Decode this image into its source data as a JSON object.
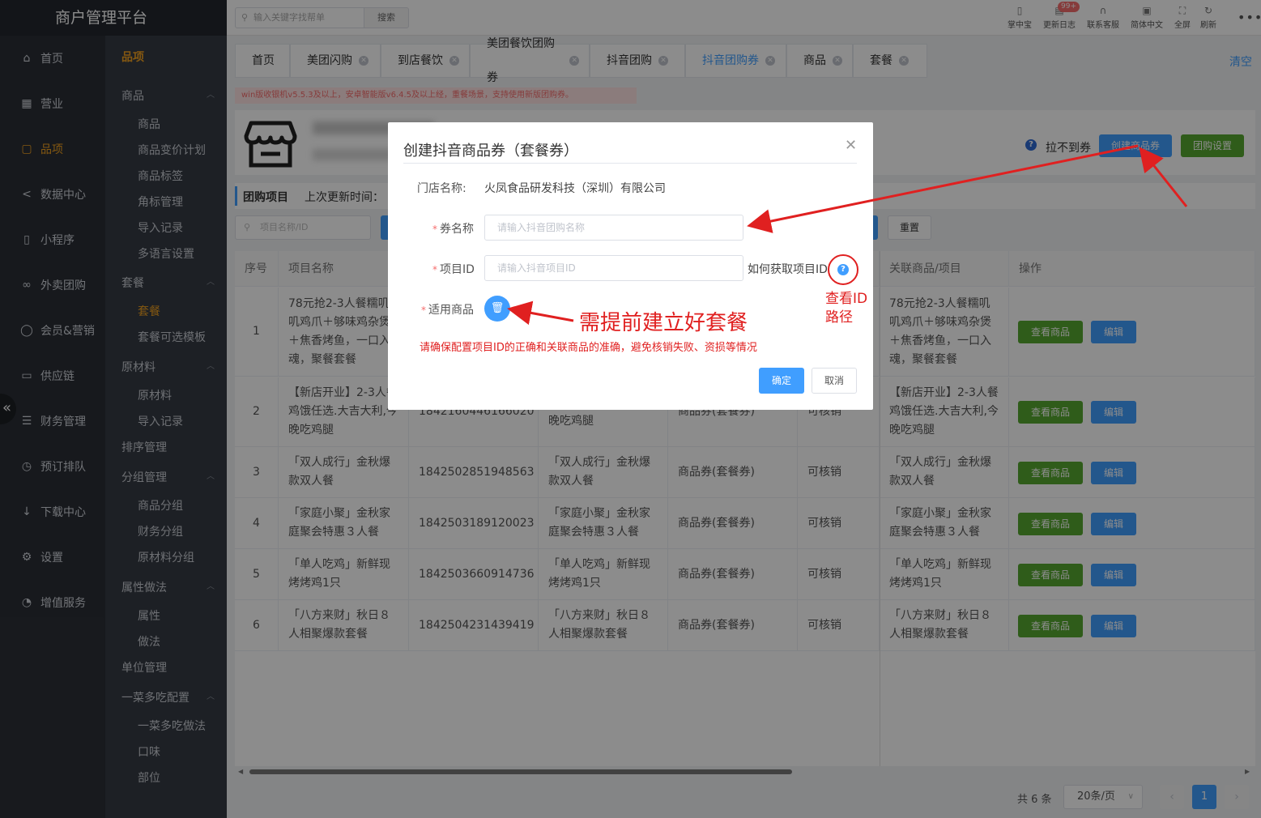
{
  "app": {
    "title": "商户管理平台"
  },
  "sidebar": {
    "items": [
      {
        "label": "首页",
        "icon": "home-icon"
      },
      {
        "label": "营业",
        "icon": "calendar-icon"
      },
      {
        "label": "品项",
        "icon": "bag-icon",
        "active": true
      },
      {
        "label": "数据中心",
        "icon": "share-icon"
      },
      {
        "label": "小程序",
        "icon": "phone-icon"
      },
      {
        "label": "外卖团购",
        "icon": "bike-icon"
      },
      {
        "label": "会员&营销",
        "icon": "user-icon"
      },
      {
        "label": "供应链",
        "icon": "truck-icon"
      },
      {
        "label": "财务管理",
        "icon": "database-icon"
      },
      {
        "label": "预订排队",
        "icon": "clock-icon"
      },
      {
        "label": "下载中心",
        "icon": "download-icon"
      },
      {
        "label": "设置",
        "icon": "gear-icon"
      },
      {
        "label": "增值服务",
        "icon": "alarm-icon"
      }
    ]
  },
  "subnav": {
    "title": "品项",
    "groups": [
      {
        "label": "商品",
        "items": [
          "商品",
          "商品变价计划",
          "商品标签",
          "角标管理",
          "导入记录",
          "多语言设置"
        ]
      },
      {
        "label": "套餐",
        "items": [
          "套餐",
          "套餐可选模板"
        ]
      },
      {
        "label": "原材料",
        "items": [
          "原材料",
          "导入记录"
        ]
      },
      {
        "label": "排序管理",
        "items": []
      },
      {
        "label": "分组管理",
        "items": [
          "商品分组",
          "财务分组",
          "原材料分组"
        ]
      },
      {
        "label": "属性做法",
        "items": [
          "属性",
          "做法"
        ]
      },
      {
        "label": "单位管理",
        "items": []
      },
      {
        "label": "一菜多吃配置",
        "items": [
          "一菜多吃做法",
          "口味",
          "部位"
        ]
      }
    ]
  },
  "topbar": {
    "search_placeholder": "输入关键字找帮单",
    "search_button": "搜索",
    "tools": [
      "掌中宝",
      "更新日志",
      "联系客服",
      "简体中文",
      "全屏",
      "刷新"
    ],
    "badge": "99+"
  },
  "tabs": {
    "items": [
      "首页",
      "美团闪购",
      "到店餐饮",
      "美团餐饮团购券",
      "抖音团购",
      "抖音团购券",
      "商品",
      "套餐"
    ],
    "active": "抖音团购券",
    "clear": "清空"
  },
  "notice": "win版收银机v5.5.3及以上，安卓智能版v6.4.5及以上经，重餐场景，支持使用新版团购券。",
  "header_actions": {
    "pull_text": "拉不到券",
    "create_coupon": "创建商品券",
    "group_settings": "团购设置"
  },
  "section": {
    "title": "团购项目",
    "last_update": "上次更新时间："
  },
  "filter": {
    "placeholder": "项目名称/ID",
    "reset": "重置"
  },
  "table": {
    "columns": [
      "序号",
      "项目名称",
      "",
      "",
      "",
      "",
      "关联商品/项目",
      "操作"
    ],
    "view_label": "查看商品",
    "edit_label": "编辑",
    "rows": [
      {
        "no": "1",
        "name": "78元抢2-3人餐糯叽叽鸡爪＋够味鸡杂煲＋焦香烤鱼，一口入魂，聚餐套餐",
        "id": "",
        "alias": "",
        "type": "",
        "status": "",
        "linked": "78元抢2-3人餐糯叽叽鸡爪＋够味鸡杂煲＋焦香烤鱼，一口入魂，聚餐套餐"
      },
      {
        "no": "2",
        "name": "【新店开业】2-3人餐鸡饿任选.大吉大利,今晚吃鸡腿",
        "id": "1842160446166020",
        "alias": "鸡饿任选.大吉大利,今晚吃鸡腿",
        "type": "商品券(套餐券)",
        "status": "可核销",
        "linked": "【新店开业】2-3人餐鸡饿任选.大吉大利,今晚吃鸡腿"
      },
      {
        "no": "3",
        "name": "「双人成行」金秋爆款双人餐",
        "id": "1842502851948563",
        "alias": "「双人成行」金秋爆款双人餐",
        "type": "商品券(套餐券)",
        "status": "可核销",
        "linked": "「双人成行」金秋爆款双人餐"
      },
      {
        "no": "4",
        "name": "「家庭小聚」金秋家庭聚会特惠３人餐",
        "id": "1842503189120023",
        "alias": "「家庭小聚」金秋家庭聚会特惠３人餐",
        "type": "商品券(套餐券)",
        "status": "可核销",
        "linked": "「家庭小聚」金秋家庭聚会特惠３人餐"
      },
      {
        "no": "5",
        "name": "「单人吃鸡」新鲜现烤烤鸡1只",
        "id": "1842503660914736",
        "alias": "「单人吃鸡」新鲜现烤烤鸡1只",
        "type": "商品券(套餐券)",
        "status": "可核销",
        "linked": "「单人吃鸡」新鲜现烤烤鸡1只"
      },
      {
        "no": "6",
        "name": "「八方来财」秋日８人相聚爆款套餐",
        "id": "1842504231439419",
        "alias": "「八方来财」秋日８人相聚爆款套餐",
        "type": "商品券(套餐券)",
        "status": "可核销",
        "linked": "「八方来财」秋日８人相聚爆款套餐"
      }
    ]
  },
  "pagination": {
    "total": "共 6 条",
    "page_size": "20条/页",
    "current": "1"
  },
  "modal": {
    "title": "创建抖音商品券（套餐券）",
    "store_label": "门店名称:",
    "store_value": "火凤食品研发科技（深圳）有限公司",
    "coupon_label": "券名称",
    "coupon_placeholder": "请输入抖音团购名称",
    "project_label": "项目ID",
    "project_placeholder": "请输入抖音项目ID",
    "how_to_id": "如何获取项目ID",
    "applicable_label": "适用商品",
    "warning": "请确保配置项目ID的正确和关联商品的准确，避免核销失败、资损等情况",
    "ok": "确定",
    "cancel": "取消"
  },
  "annotations": {
    "prep": "需提前建立好套餐",
    "view_id_1": "查看ID",
    "view_id_2": "路径"
  },
  "colors": {
    "primary": "#409eff",
    "success": "#56a830",
    "danger": "#e02020",
    "sidebar": "#2b2f36",
    "active": "#f0a020"
  }
}
